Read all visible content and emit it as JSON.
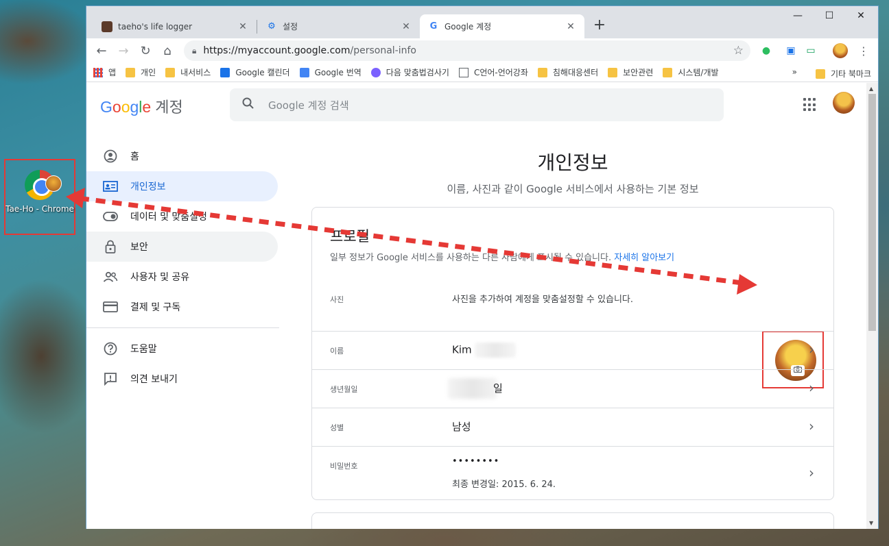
{
  "desktop": {
    "icon_label": "Tae-Ho - Chrome"
  },
  "window": {
    "tabs": [
      {
        "title": "taeho's life logger",
        "icon": "blog-icon",
        "close": "✕"
      },
      {
        "title": "설정",
        "icon": "gear-icon",
        "close": "✕"
      },
      {
        "title": "Google 계정",
        "icon": "google-icon",
        "close": "✕"
      }
    ],
    "new_tab": "+",
    "controls": {
      "minimize": "—",
      "maximize": "☐",
      "close": "✕"
    }
  },
  "toolbar": {
    "url_host": "https://myaccount.google.com",
    "url_path": "/personal-info"
  },
  "bookmarks": {
    "items": [
      "앱",
      "개인",
      "내서비스",
      "Google 캘린더",
      "Google 번역",
      "다음 맞춤법검사기",
      "C언어-언어강좌",
      "침해대응센터",
      "보안관련",
      "시스템/개발"
    ],
    "more": "»",
    "other": "기타 북마크",
    "colors": {
      "folder": "#f6c343",
      "calendar": "#1a73e8",
      "translate": "#4285f4",
      "daum": "#7b61ff"
    }
  },
  "header": {
    "logo_google": [
      "G",
      "o",
      "o",
      "g",
      "l",
      "e"
    ],
    "logo_account": "계정",
    "search_placeholder": "Google 계정 검색"
  },
  "sidebar": {
    "items": [
      {
        "label": "홈",
        "icon": "home-icon"
      },
      {
        "label": "개인정보",
        "icon": "id-card-icon",
        "active": true
      },
      {
        "label": "데이터 및 맞춤설정",
        "icon": "toggle-icon"
      },
      {
        "label": "보안",
        "icon": "lock-icon"
      },
      {
        "label": "사용자 및 공유",
        "icon": "people-icon"
      },
      {
        "label": "결제 및 구독",
        "icon": "card-icon"
      }
    ],
    "bottom_items": [
      {
        "label": "도움말",
        "icon": "help-icon"
      },
      {
        "label": "의견 보내기",
        "icon": "feedback-icon"
      }
    ]
  },
  "main": {
    "title": "개인정보",
    "subtitle": "이름, 사진과 같이 Google 서비스에서 사용하는 기본 정보",
    "profile": {
      "title": "프로필",
      "desc": "일부 정보가 Google 서비스를 사용하는 다른 사람에게 표시될 수 있습니다.",
      "desc_link": "자세히 알아보기",
      "rows": [
        {
          "label": "사진",
          "value": "사진을 추가하여 계정을 맞춤설정할 수 있습니다."
        },
        {
          "label": "이름",
          "value": "Kim"
        },
        {
          "label": "생년월일",
          "value": "일"
        },
        {
          "label": "성별",
          "value": "남성"
        },
        {
          "label": "비밀번호",
          "value": "••••••••",
          "sub": "최종 변경일: 2015. 6. 24."
        }
      ]
    }
  },
  "colors": {
    "accent_blue": "#1a73e8",
    "active_bg": "#e8f0fe",
    "annotation_red": "#e53935"
  }
}
